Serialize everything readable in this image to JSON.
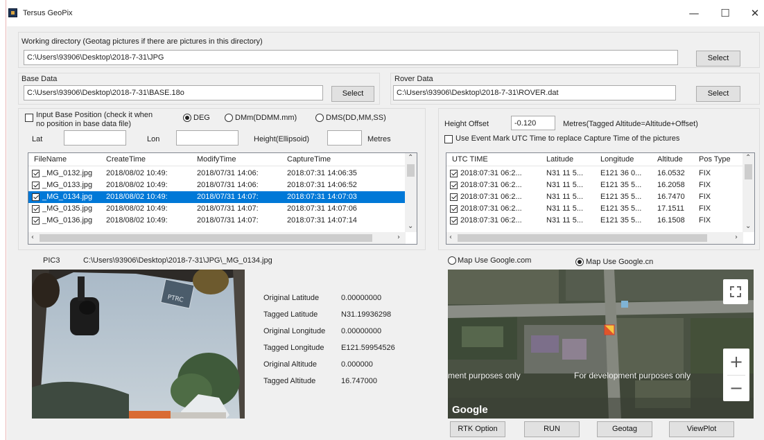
{
  "window": {
    "title": "Tersus GeoPix",
    "minimize_glyph": "—",
    "maximize_glyph": "☐",
    "close_glyph": "✕"
  },
  "working_dir": {
    "label": "Working directory (Geotag pictures if there are pictures in this directory)",
    "value": "C:\\Users\\93906\\Desktop\\2018-7-31\\JPG",
    "select_label": "Select"
  },
  "base_data": {
    "label": "Base Data",
    "value": "C:\\Users\\93906\\Desktop\\2018-7-31\\BASE.18o",
    "select_label": "Select"
  },
  "rover_data": {
    "label": "Rover Data",
    "value": "C:\\Users\\93906\\Desktop\\2018-7-31\\ROVER.dat",
    "select_label": "Select"
  },
  "base_position": {
    "input_label_1": "Input Base Position (check it when",
    "input_label_2": "no position in base data file)",
    "checked": false,
    "format_options": [
      {
        "label": "DEG",
        "selected": true
      },
      {
        "label": "DMm(DDMM.mm)",
        "selected": false
      },
      {
        "label": "DMS(DD,MM,SS)",
        "selected": false
      }
    ],
    "lat_label": "Lat",
    "lat_value": "",
    "lon_label": "Lon",
    "lon_value": "",
    "height_label": "Height(Ellipsoid)",
    "height_value": "",
    "metres_label": "Metres"
  },
  "height_offset": {
    "label": "Height Offset",
    "value": "-0.120",
    "note": "Metres(Tagged Altitude=Altitude+Offset)",
    "event_mark_label": "Use Event Mark UTC Time to replace Capture Time of the pictures",
    "event_mark_checked": false
  },
  "file_list": {
    "columns": [
      "FileName",
      "CreateTime",
      "ModifyTime",
      "CaptureTime"
    ],
    "rows": [
      {
        "file": "_MG_0132.jpg",
        "create": "2018/08/02 10:49:",
        "modify": "2018/07/31 14:06:",
        "capture": "2018:07:31 14:06:35",
        "selected": false
      },
      {
        "file": "_MG_0133.jpg",
        "create": "2018/08/02 10:49:",
        "modify": "2018/07/31 14:06:",
        "capture": "2018:07:31 14:06:52",
        "selected": false
      },
      {
        "file": "_MG_0134.jpg",
        "create": "2018/08/02 10:49:",
        "modify": "2018/07/31 14:07:",
        "capture": "2018:07:31 14:07:03",
        "selected": true
      },
      {
        "file": "_MG_0135.jpg",
        "create": "2018/08/02 10:49:",
        "modify": "2018/07/31 14:07:",
        "capture": "2018:07:31 14:07:06",
        "selected": false
      },
      {
        "file": "_MG_0136.jpg",
        "create": "2018/08/02 10:49:",
        "modify": "2018/07/31 14:07:",
        "capture": "2018:07:31 14:07:14",
        "selected": false
      }
    ]
  },
  "rover_list": {
    "columns": [
      "UTC TIME",
      "Latitude",
      "Longitude",
      "Altitude",
      "Pos Type"
    ],
    "rows": [
      {
        "utc": "2018:07:31 06:2...",
        "lat": "N31 11 5...",
        "lon": "E121 36 0...",
        "alt": "16.0532",
        "pos": "FIX"
      },
      {
        "utc": "2018:07:31 06:2...",
        "lat": "N31 11 5...",
        "lon": "E121 35 5...",
        "alt": "16.2058",
        "pos": "FIX"
      },
      {
        "utc": "2018:07:31 06:2...",
        "lat": "N31 11 5...",
        "lon": "E121 35 5...",
        "alt": "16.7470",
        "pos": "FIX"
      },
      {
        "utc": "2018:07:31 06:2...",
        "lat": "N31 11 5...",
        "lon": "E121 35 5...",
        "alt": "17.1511",
        "pos": "FIX"
      },
      {
        "utc": "2018:07:31 06:2...",
        "lat": "N31 11 5...",
        "lon": "E121 35 5...",
        "alt": "16.1508",
        "pos": "FIX"
      }
    ]
  },
  "picture": {
    "label": "PIC3",
    "path": "C:\\Users\\93906\\Desktop\\2018-7-31\\JPG\\_MG_0134.jpg",
    "sticker_text": "PTRC"
  },
  "coords": [
    {
      "label": "Original Latitude",
      "value": "0.00000000"
    },
    {
      "label": "Tagged Latitude",
      "value": "N31.19936298"
    },
    {
      "label": "Original Longitude",
      "value": "0.00000000"
    },
    {
      "label": "Tagged Longitude",
      "value": "E121.59954526"
    },
    {
      "label": "Original Altitude",
      "value": "0.000000"
    },
    {
      "label": "Tagged Altitude",
      "value": "16.747000"
    }
  ],
  "map": {
    "options": [
      {
        "label": "Map Use Google.com",
        "selected": false
      },
      {
        "label": "Map Use Google.cn",
        "selected": true
      }
    ],
    "watermark_left": "ment purposes only",
    "watermark_right": "For development purposes only",
    "google_label": "Google",
    "zoom_in": "+",
    "zoom_out": "−"
  },
  "actions": {
    "rtk_option": "RTK Option",
    "run": "RUN",
    "geotag": "Geotag",
    "viewplot": "ViewPlot"
  }
}
